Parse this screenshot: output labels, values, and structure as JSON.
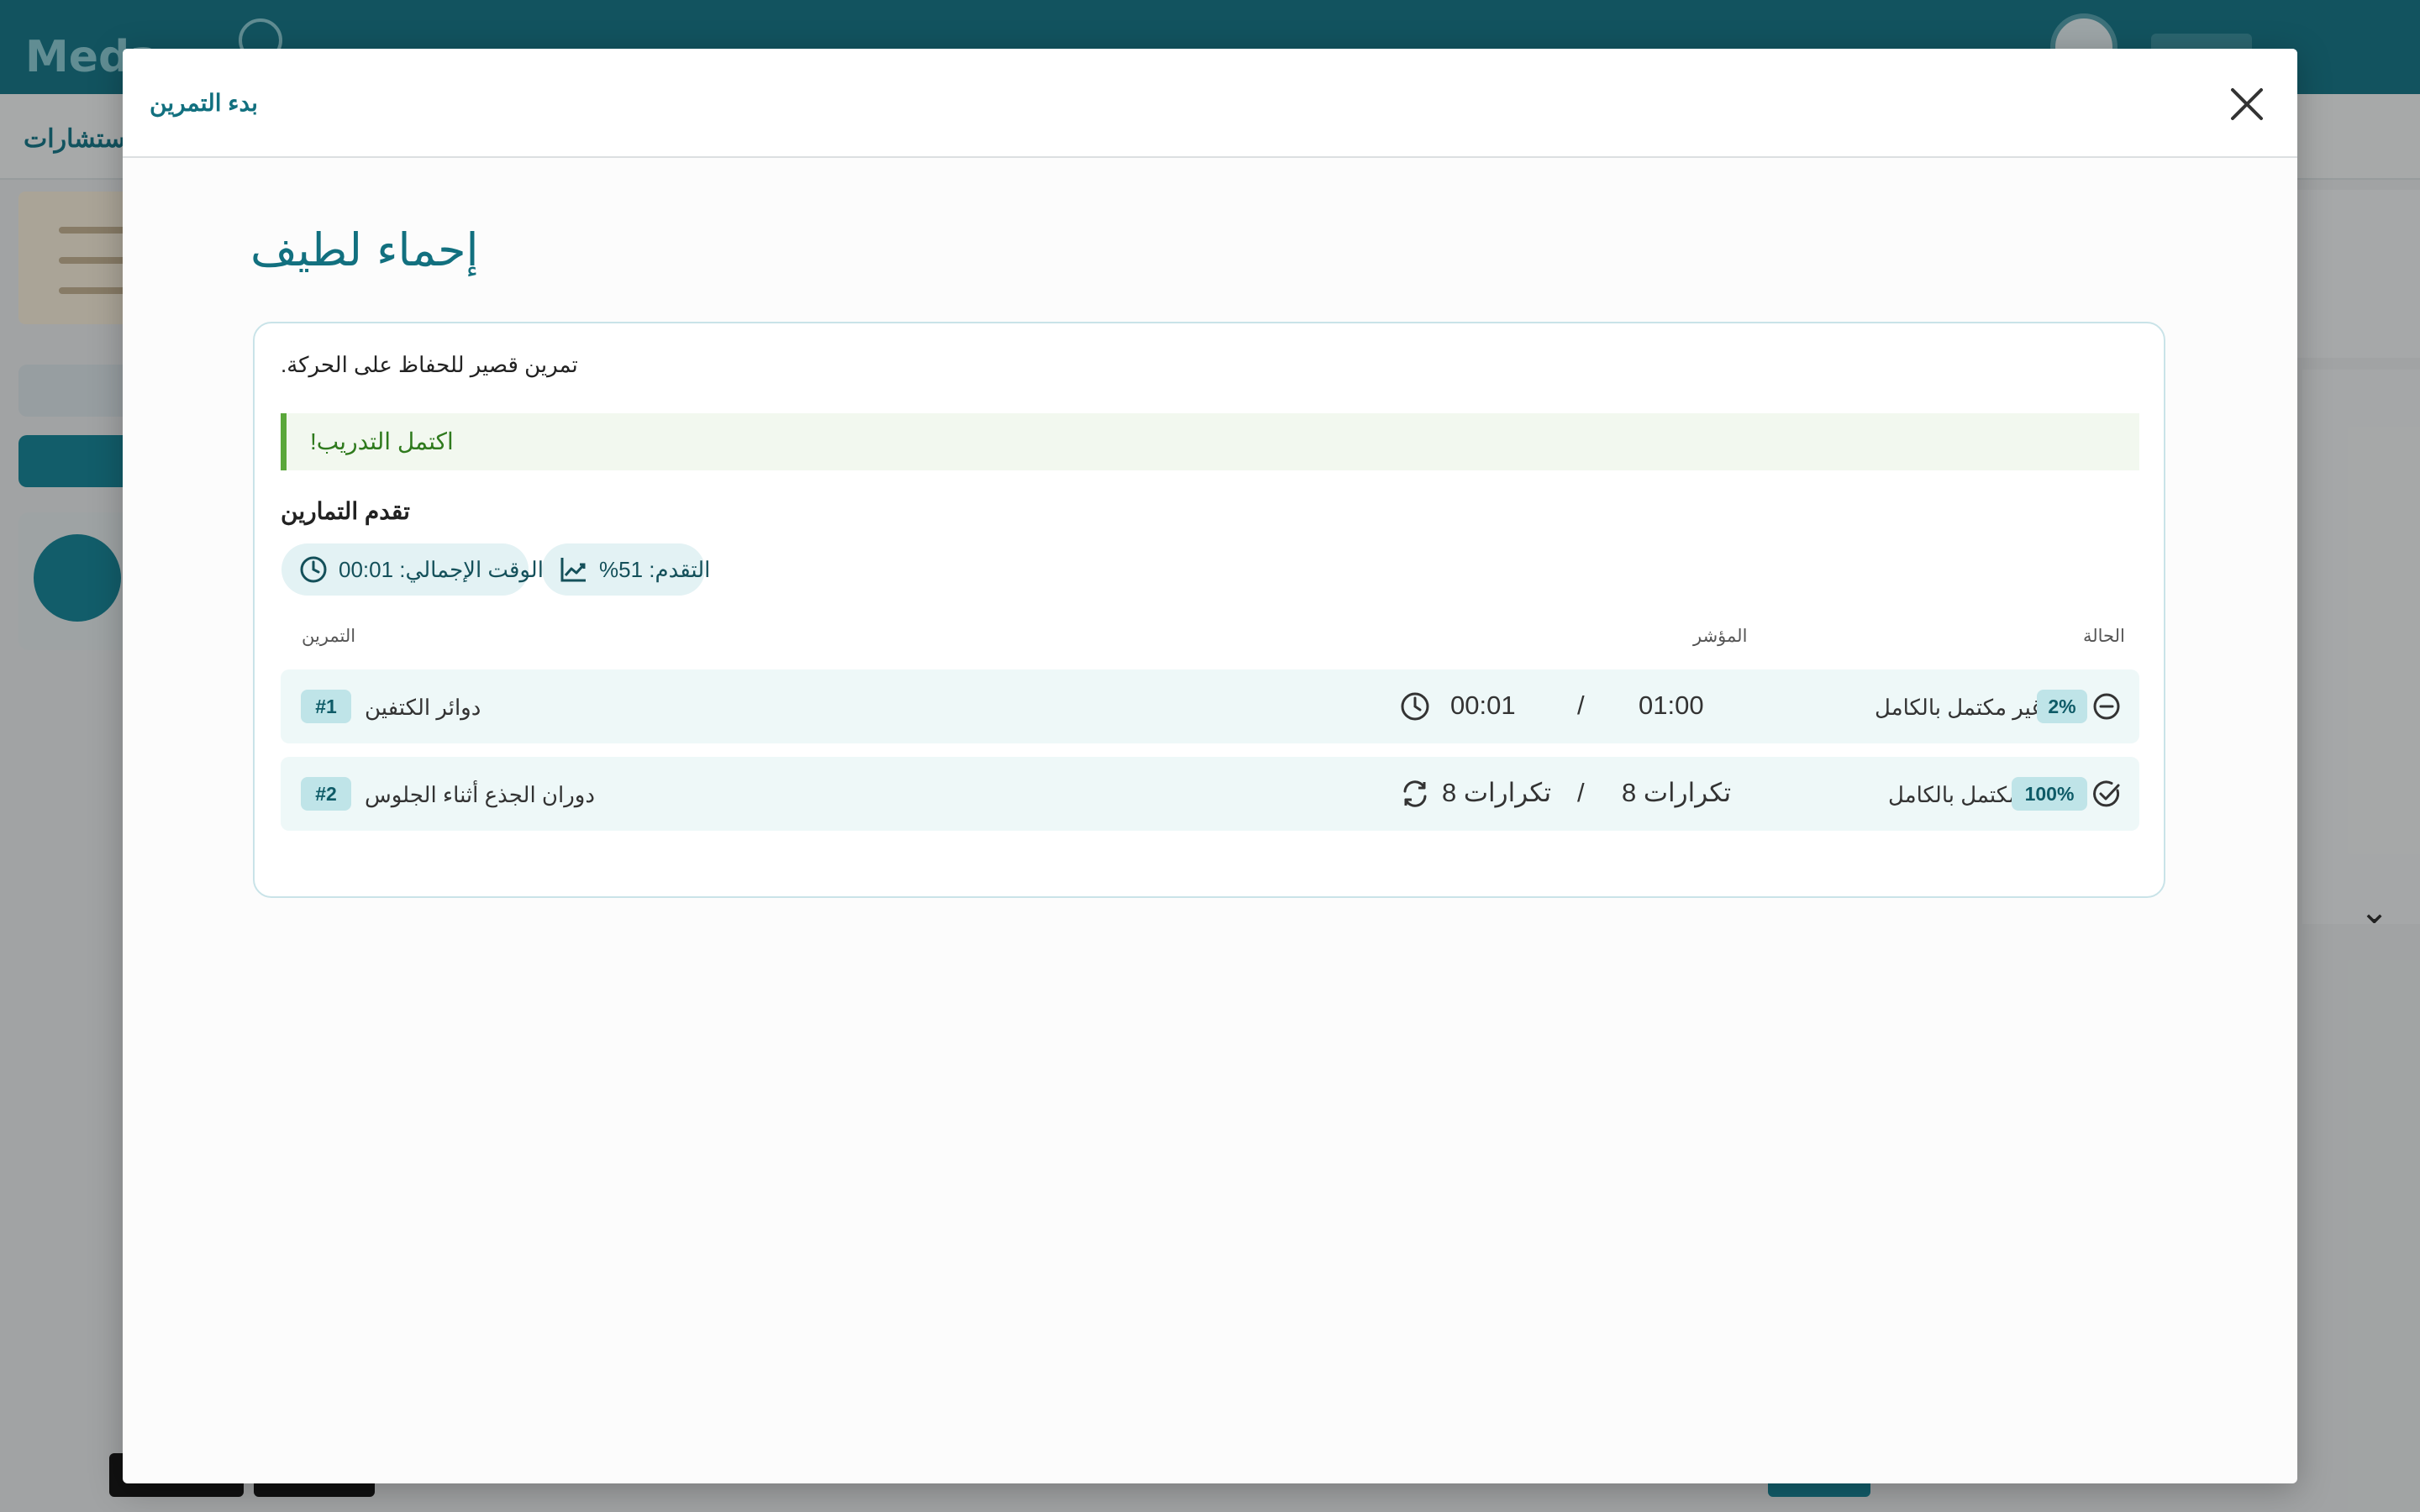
{
  "modal": {
    "title": "بدء التمرين",
    "workout_title": "إحماء لطيف",
    "description": "تمرين قصير للحفاظ على الحركة.",
    "alert": "اكتمل التدريب!",
    "progress_heading": "تقدم التمارين",
    "chips": {
      "total_time": "الوقت الإجمالي: 00:01",
      "progress": "التقدم: 51%"
    },
    "columns": {
      "exercise": "التمرين",
      "indicator": "المؤشر",
      "status": "الحالة"
    },
    "exercises": [
      {
        "index": "#1",
        "name": "دوائر الكتفين",
        "metric_icon": "clock-icon",
        "done": "00:01",
        "slash": "/",
        "target": "01:00",
        "percent": "2%",
        "percent_value": 2,
        "status": "غير مكتمل بالكامل",
        "status_icon": "minus-circle-icon"
      },
      {
        "index": "#2",
        "name": "دوران الجذع أثناء الجلوس",
        "metric_icon": "repeat-icon",
        "done": "تكرارات 8",
        "slash": "/",
        "target": "تكرارات 8",
        "percent": "100%",
        "percent_value": 100,
        "status": "مكتمل بالكامل",
        "status_icon": "check-circle-icon"
      }
    ]
  },
  "background": {
    "app_name": "Meda",
    "subnav_label": "استشارات"
  },
  "colors": {
    "primary": "#12707f",
    "header_bg": "#1b7b8c",
    "success": "#5aa73a",
    "row_bg": "#eef8f8",
    "badge_bg": "#bfe4e8"
  }
}
